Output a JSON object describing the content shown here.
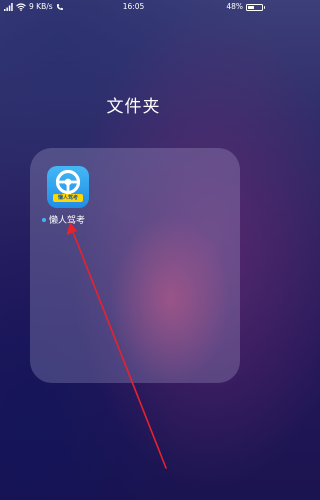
{
  "status_bar": {
    "network_speed": "9 KB/s",
    "time": "16:05",
    "battery_percent": "48%",
    "battery_level": 0.48,
    "icons": [
      "signal-icon",
      "wifi-icon",
      "call-icon",
      "battery-icon"
    ]
  },
  "folder": {
    "title": "文件夹",
    "apps": [
      {
        "name": "懒人驾考",
        "icon": "steering-wheel-icon",
        "icon_banner_text": "懒人驾考",
        "has_new_badge": true
      }
    ]
  },
  "colors": {
    "arrow": "#e8222b",
    "icon_blue": "#2196f3",
    "icon_banner": "#ffd600",
    "new_dot": "#46b3ff"
  }
}
